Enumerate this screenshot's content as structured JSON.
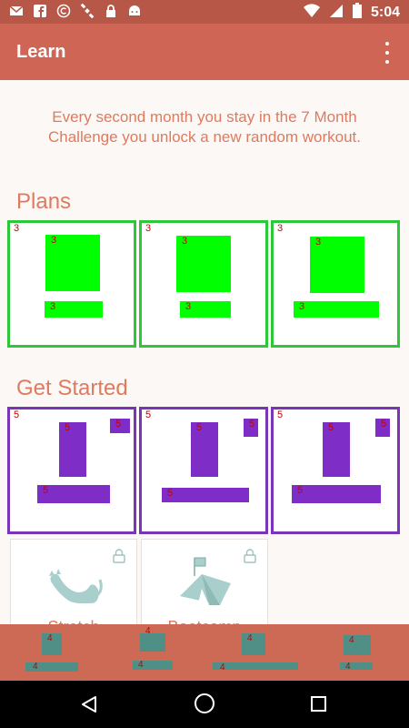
{
  "status": {
    "time": "5:04"
  },
  "app": {
    "title": "Learn"
  },
  "intro": {
    "text": "Every second month you stay in the 7 Month Challenge you unlock a new random workout."
  },
  "sections": {
    "plans": "Plans",
    "started": "Get Started"
  },
  "plans": [
    {
      "badge": "3",
      "img_badge": "3",
      "bar_badge": "3"
    },
    {
      "badge": "3",
      "img_badge": "3",
      "bar_badge": "3"
    },
    {
      "badge": "3",
      "img_badge": "3",
      "bar_badge": "3"
    }
  ],
  "started": [
    {
      "badge": "5",
      "tall_badge": "5",
      "small_badge": "5",
      "bar_badge": "5"
    },
    {
      "badge": "5",
      "tall_badge": "5",
      "small_badge": "5",
      "bar_badge": "5"
    },
    {
      "badge": "5",
      "tall_badge": "5",
      "small_badge": "5",
      "bar_badge": "5"
    }
  ],
  "workouts": [
    {
      "label": "Stretch",
      "icon": "cat-stretch-icon",
      "locked": true
    },
    {
      "label": "Bootcamp",
      "icon": "tent-icon",
      "locked": true
    }
  ],
  "bottom_nav": [
    {
      "badge_top": "4",
      "badge_bottom": "4"
    },
    {
      "badge_top": "4",
      "badge_bottom": "4"
    },
    {
      "badge_top": "4",
      "badge_bottom": "4"
    },
    {
      "badge_top": "4",
      "badge_bottom": "4"
    }
  ],
  "colors": {
    "primary": "#cf6655",
    "primary_dark": "#b65747",
    "accent_text": "#e07a5f",
    "plans_border": "#2dc73a",
    "started_border": "#7a34b8"
  }
}
